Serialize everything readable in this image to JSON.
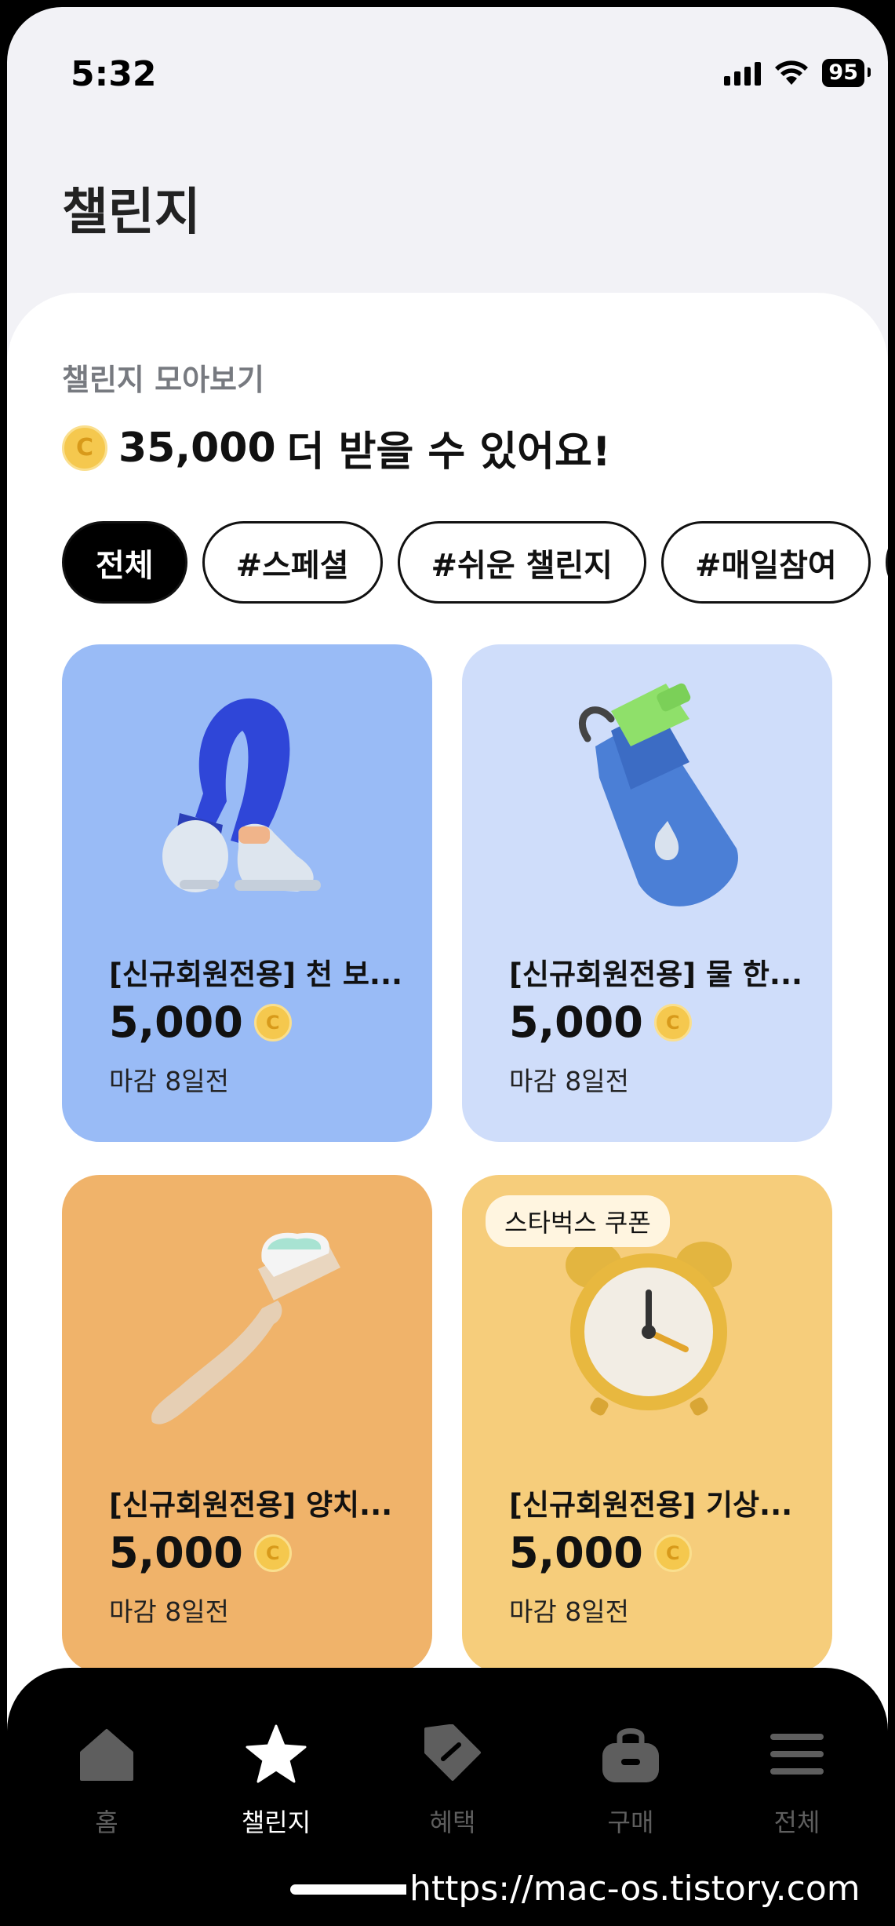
{
  "status_bar": {
    "time": "5:32",
    "battery": "95"
  },
  "page": {
    "title": "챌린지"
  },
  "summary": {
    "section_label": "챌린지 모아보기",
    "coin_glyph": "C",
    "amount": "35,000",
    "suffix": "더 받을 수 있어요!"
  },
  "filters": [
    {
      "label": "전체",
      "selected": true
    },
    {
      "label": "#스페셜"
    },
    {
      "label": "#쉬운 챌린지"
    },
    {
      "label": "#매일참여"
    },
    {
      "label": "#"
    }
  ],
  "cards": [
    {
      "title": "[신규회원전용] 천 보...",
      "reward": "5,000",
      "deadline": "마감 8일전",
      "bg": "#99bbf6",
      "icon": "legs-walking-icon"
    },
    {
      "title": "[신규회원전용] 물 한...",
      "reward": "5,000",
      "deadline": "마감 8일전",
      "bg": "#cfddfa",
      "icon": "water-bottle-icon"
    },
    {
      "title": "[신규회원전용] 양치...",
      "reward": "5,000",
      "deadline": "마감 8일전",
      "bg": "#f0b36a",
      "icon": "toothbrush-icon"
    },
    {
      "title": "[신규회원전용] 기상...",
      "reward": "5,000",
      "deadline": "마감 8일전",
      "bg": "#f6cd7b",
      "icon": "alarm-clock-icon",
      "badge": "스타벅스 쿠폰"
    }
  ],
  "tabbar": [
    {
      "label": "홈",
      "icon": "home-icon"
    },
    {
      "label": "챌린지",
      "icon": "star-icon",
      "active": true
    },
    {
      "label": "혜택",
      "icon": "tag-icon"
    },
    {
      "label": "구매",
      "icon": "shopping-bag-icon"
    },
    {
      "label": "전체",
      "icon": "menu-icon"
    }
  ],
  "watermark": "https://mac-os.tistory.com"
}
